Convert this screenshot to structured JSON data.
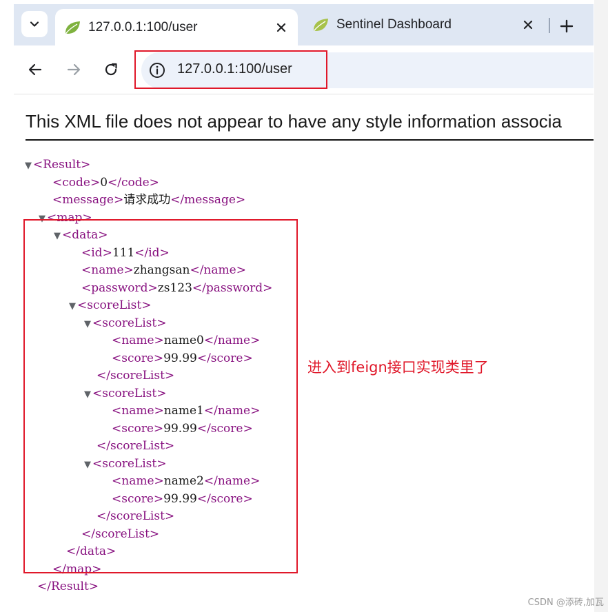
{
  "browser": {
    "tabs": [
      {
        "title": "127.0.0.1:100/user",
        "active": true,
        "icon": "spring-leaf-icon"
      },
      {
        "title": "Sentinel Dashboard",
        "active": false,
        "icon": "spring-leaf-icon"
      }
    ],
    "address": "127.0.0.1:100/user"
  },
  "page": {
    "xml_notice": "This XML file does not appear to have any style information associa"
  },
  "xml": {
    "lines": [
      {
        "open": "<Result>"
      },
      {
        "open": "<code>",
        "value": "0",
        "close": "</code>"
      },
      {
        "open": "<message>",
        "value": "请求成功",
        "close": "</message>"
      },
      {
        "open": "<map>"
      },
      {
        "open": "<data>"
      },
      {
        "open": "<id>",
        "value": "111",
        "close": "</id>"
      },
      {
        "open": "<name>",
        "value": "zhangsan",
        "close": "</name>"
      },
      {
        "open": "<password>",
        "value": "zs123",
        "close": "</password>"
      },
      {
        "open": "<scoreList>"
      },
      {
        "open": "<scoreList>"
      },
      {
        "open": "<name>",
        "value": "name0",
        "close": "</name>"
      },
      {
        "open": "<score>",
        "value": "99.99",
        "close": "</score>"
      },
      {
        "close": "</scoreList>"
      },
      {
        "open": "<scoreList>"
      },
      {
        "open": "<name>",
        "value": "name1",
        "close": "</name>"
      },
      {
        "open": "<score>",
        "value": "99.99",
        "close": "</score>"
      },
      {
        "close": "</scoreList>"
      },
      {
        "open": "<scoreList>"
      },
      {
        "open": "<name>",
        "value": "name2",
        "close": "</name>"
      },
      {
        "open": "<score>",
        "value": "99.99",
        "close": "</score>"
      },
      {
        "close": "</scoreList>"
      },
      {
        "close": "</scoreList>"
      },
      {
        "close": "</data>"
      },
      {
        "close": "</map>"
      },
      {
        "close": "</Result>"
      }
    ]
  },
  "annotation": "进入到feign接口实现类里了",
  "watermark": "CSDN @添砖,加瓦",
  "colors": {
    "tag": "#881280",
    "highlight_box": "#e0182a",
    "tab_bar": "#dfe7f3",
    "omnibox": "#edf2fa"
  }
}
